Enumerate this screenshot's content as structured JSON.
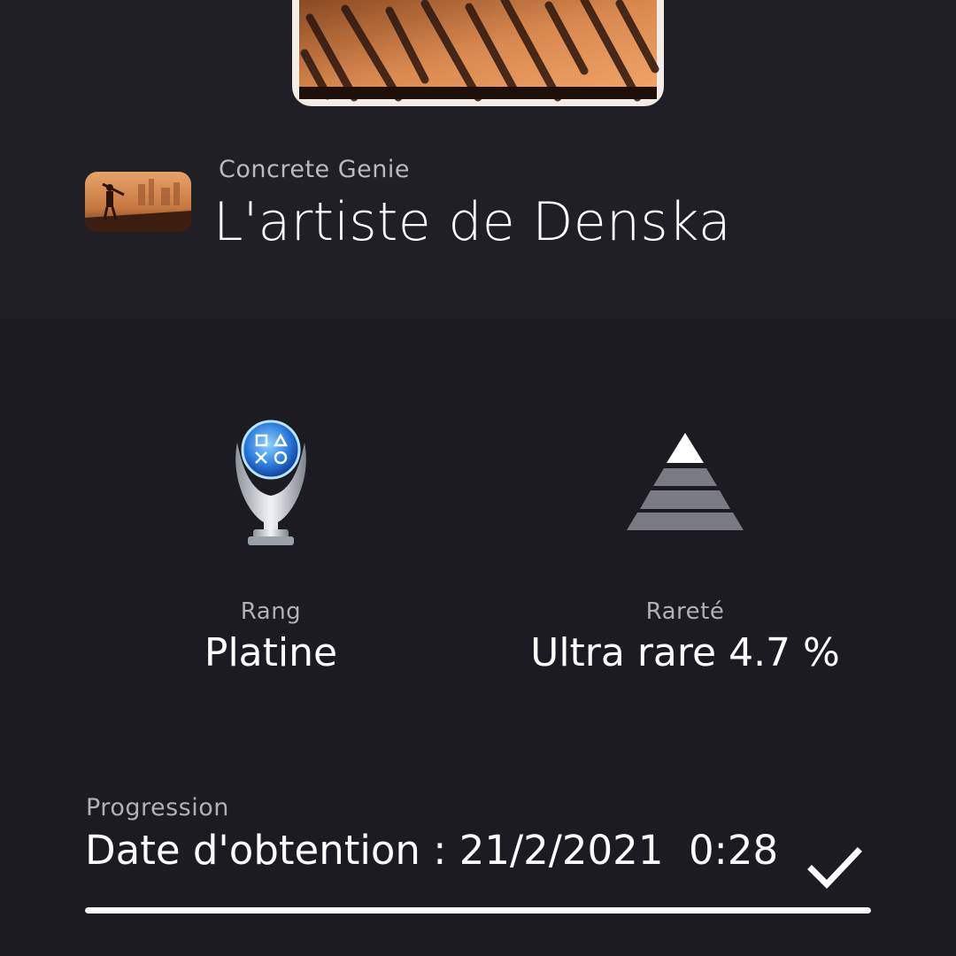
{
  "game": {
    "title": "Concrete Genie",
    "thumbnail_icon": "concrete-genie-thumbnail"
  },
  "trophy": {
    "name": "L'artiste de Denska",
    "banner_icon": "concrete-genie-banner-art"
  },
  "stats": {
    "rank": {
      "label": "Rang",
      "value": "Platine",
      "icon": "platinum-trophy-icon"
    },
    "rarity": {
      "label": "Rareté",
      "value": "Ultra rare 4.7 %",
      "icon": "rarity-pyramid-icon"
    }
  },
  "progress": {
    "label": "Progression",
    "earned_text": "Date d'obtention : 21/2/2021  0:28",
    "percent": 100,
    "status_icon": "checkmark-icon"
  },
  "colors": {
    "background": "#1b1b21",
    "header_band": "#1f1f25",
    "secondary_text": "#b0b0b8",
    "primary_text": "#ffffff",
    "progress_fill": "#ffffff"
  }
}
